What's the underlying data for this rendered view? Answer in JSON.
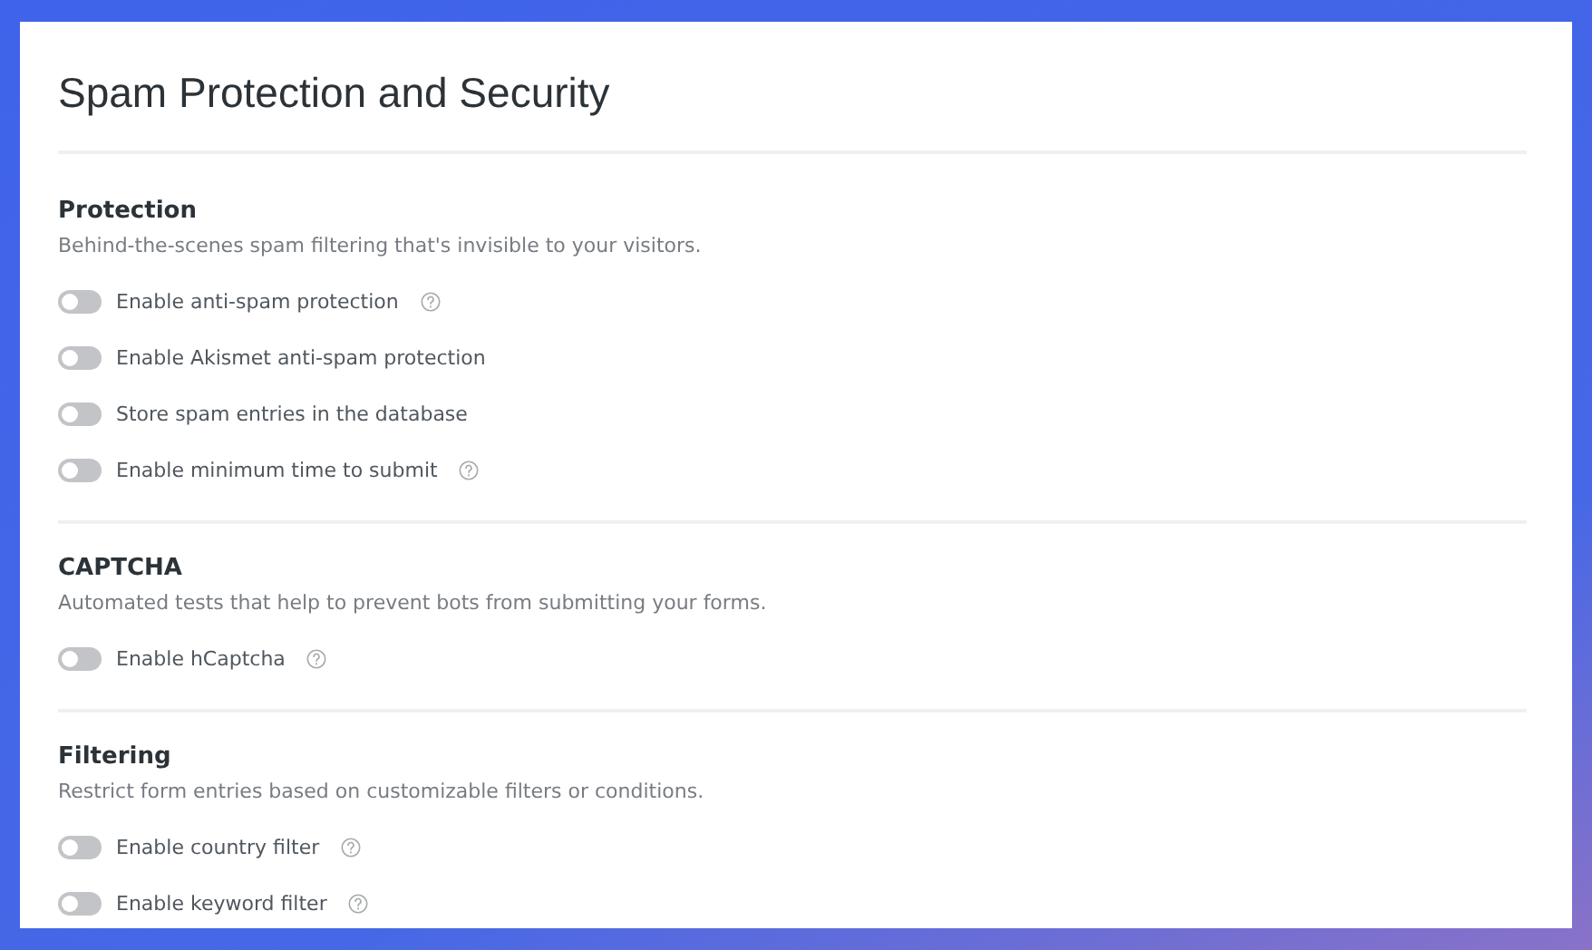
{
  "page": {
    "title": "Spam Protection and Security"
  },
  "sections": [
    {
      "title": "Protection",
      "description": "Behind-the-scenes spam filtering that's invisible to your visitors.",
      "options": [
        {
          "label": "Enable anti-spam protection",
          "on": false,
          "help": true
        },
        {
          "label": "Enable Akismet anti-spam protection",
          "on": false,
          "help": false
        },
        {
          "label": "Store spam entries in the database",
          "on": false,
          "help": false
        },
        {
          "label": "Enable minimum time to submit",
          "on": false,
          "help": true
        }
      ]
    },
    {
      "title": "CAPTCHA",
      "description": "Automated tests that help to prevent bots from submitting your forms.",
      "options": [
        {
          "label": "Enable hCaptcha",
          "on": false,
          "help": true
        }
      ]
    },
    {
      "title": "Filtering",
      "description": "Restrict form entries based on customizable filters or conditions.",
      "options": [
        {
          "label": "Enable country filter",
          "on": false,
          "help": true
        },
        {
          "label": "Enable keyword filter",
          "on": false,
          "help": true
        }
      ]
    }
  ]
}
